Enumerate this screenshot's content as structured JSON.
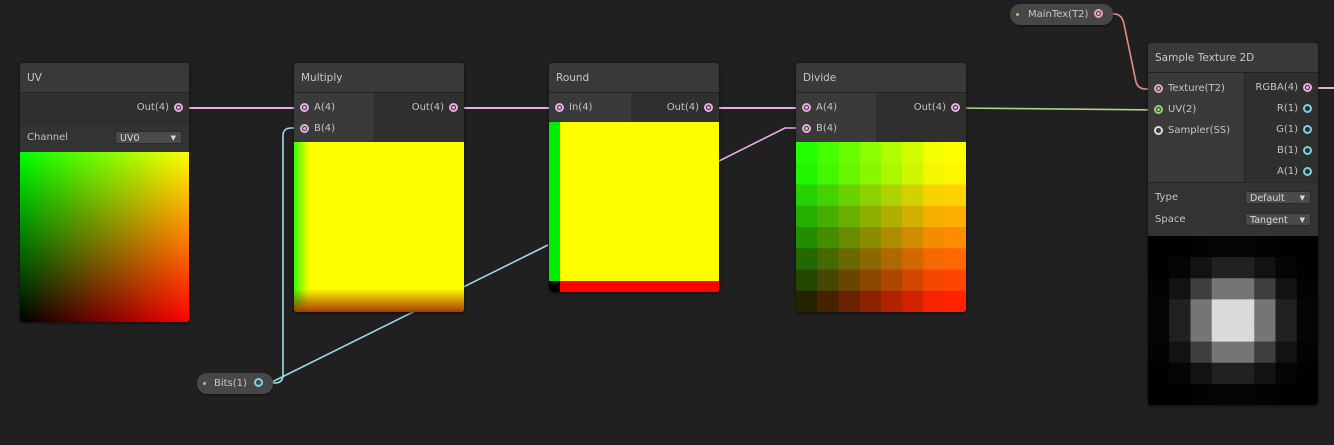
{
  "nodes": {
    "uv": {
      "title": "UV",
      "out_label": "Out(4)",
      "channel_label": "Channel",
      "channel_value": "UV0"
    },
    "multiply": {
      "title": "Multiply",
      "in_a": "A(4)",
      "in_b": "B(4)",
      "out_label": "Out(4)"
    },
    "round": {
      "title": "Round",
      "in_label": "In(4)",
      "out_label": "Out(4)"
    },
    "divide": {
      "title": "Divide",
      "in_a": "A(4)",
      "in_b": "B(4)",
      "out_label": "Out(4)"
    },
    "sample_texture": {
      "title": "Sample Texture 2D",
      "inputs": [
        "Texture(T2)",
        "UV(2)",
        "Sampler(SS)"
      ],
      "outputs": [
        "RGBA(4)",
        "R(1)",
        "G(1)",
        "B(1)",
        "A(1)"
      ],
      "type_label": "Type",
      "type_value": "Default",
      "space_label": "Space",
      "space_value": "Tangent"
    }
  },
  "properties": {
    "bits": {
      "label": "Bits(1)"
    },
    "maintex": {
      "label": "MainTex(T2)"
    }
  },
  "colors": {
    "background": "#202020",
    "vector4_wire": "#e7aee2",
    "vector2_wire": "#8fd46a",
    "vector1_wire": "#7ad3e0",
    "texture_wire": "#e88a8a"
  }
}
